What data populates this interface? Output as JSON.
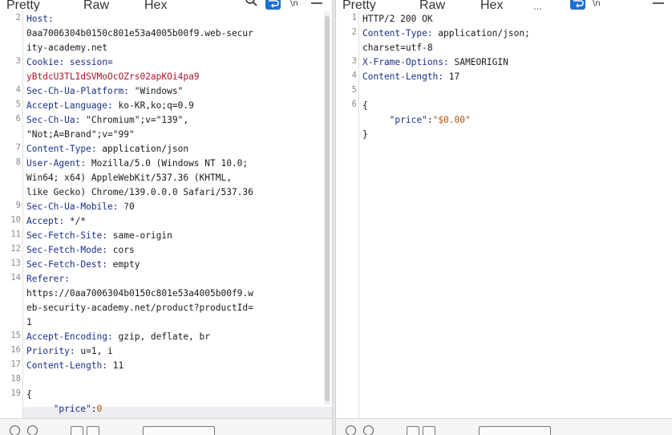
{
  "tabs": {
    "pretty": "Pretty",
    "raw": "Raw",
    "hex": "Hex",
    "more": "..."
  },
  "request": {
    "lines": [
      {
        "n": "2",
        "parts": [
          {
            "t": "Host:",
            "c": "hk"
          }
        ]
      },
      {
        "n": "",
        "parts": [
          {
            "t": "0aa7006304b0150c801e53a4005b00f9.web-secur",
            "c": ""
          }
        ]
      },
      {
        "n": "",
        "parts": [
          {
            "t": "ity-academy.net",
            "c": ""
          }
        ]
      },
      {
        "n": "3",
        "parts": [
          {
            "t": "Cookie: session=",
            "c": "hk"
          }
        ]
      },
      {
        "n": "",
        "parts": [
          {
            "t": "yBtdcU3TLIdSVMoOcOZrs02apKOi4pa9",
            "c": "rv"
          }
        ]
      },
      {
        "n": "4",
        "parts": [
          {
            "t": "Sec-Ch-Ua-Platform:",
            "c": "hk"
          },
          {
            "t": " \"Windows\"",
            "c": ""
          }
        ]
      },
      {
        "n": "5",
        "parts": [
          {
            "t": "Accept-Language:",
            "c": "hk"
          },
          {
            "t": " ko-KR,ko;q=0.9",
            "c": ""
          }
        ]
      },
      {
        "n": "6",
        "parts": [
          {
            "t": "Sec-Ch-Ua:",
            "c": "hk"
          },
          {
            "t": " \"Chromium\";v=\"139\",",
            "c": ""
          }
        ]
      },
      {
        "n": "",
        "parts": [
          {
            "t": "\"Not;A=Brand\";v=\"99\"",
            "c": ""
          }
        ]
      },
      {
        "n": "7",
        "parts": [
          {
            "t": "Content-Type:",
            "c": "hk"
          },
          {
            "t": " application/json",
            "c": ""
          }
        ]
      },
      {
        "n": "8",
        "parts": [
          {
            "t": "User-Agent:",
            "c": "hk"
          },
          {
            "t": " Mozilla/5.0 (Windows NT 10.0;",
            "c": ""
          }
        ]
      },
      {
        "n": "",
        "parts": [
          {
            "t": "Win64; x64) AppleWebKit/537.36 (KHTML,",
            "c": ""
          }
        ]
      },
      {
        "n": "",
        "parts": [
          {
            "t": "like Gecko) Chrome/139.0.0.0 Safari/537.36",
            "c": ""
          }
        ]
      },
      {
        "n": "9",
        "parts": [
          {
            "t": "Sec-Ch-Ua-Mobile:",
            "c": "hk"
          },
          {
            "t": " ?0",
            "c": ""
          }
        ]
      },
      {
        "n": "10",
        "parts": [
          {
            "t": "Accept:",
            "c": "hk"
          },
          {
            "t": " */*",
            "c": ""
          }
        ]
      },
      {
        "n": "11",
        "parts": [
          {
            "t": "Sec-Fetch-Site:",
            "c": "hk"
          },
          {
            "t": " same-origin",
            "c": ""
          }
        ]
      },
      {
        "n": "12",
        "parts": [
          {
            "t": "Sec-Fetch-Mode:",
            "c": "hk"
          },
          {
            "t": " cors",
            "c": ""
          }
        ]
      },
      {
        "n": "13",
        "parts": [
          {
            "t": "Sec-Fetch-Dest:",
            "c": "hk"
          },
          {
            "t": " empty",
            "c": ""
          }
        ]
      },
      {
        "n": "14",
        "parts": [
          {
            "t": "Referer:",
            "c": "hk"
          }
        ]
      },
      {
        "n": "",
        "parts": [
          {
            "t": "https://0aa7006304b0150c801e53a4005b00f9.w",
            "c": ""
          }
        ]
      },
      {
        "n": "",
        "parts": [
          {
            "t": "eb-security-academy.net/product?productId=",
            "c": ""
          }
        ]
      },
      {
        "n": "",
        "parts": [
          {
            "t": "1",
            "c": ""
          }
        ]
      },
      {
        "n": "15",
        "parts": [
          {
            "t": "Accept-Encoding:",
            "c": "hk"
          },
          {
            "t": " gzip, deflate, br",
            "c": ""
          }
        ]
      },
      {
        "n": "16",
        "parts": [
          {
            "t": "Priority:",
            "c": "hk"
          },
          {
            "t": " u=1, i",
            "c": ""
          }
        ]
      },
      {
        "n": "17",
        "parts": [
          {
            "t": "Content-Length:",
            "c": "hk"
          },
          {
            "t": " 11",
            "c": ""
          }
        ]
      },
      {
        "n": "18",
        "parts": []
      },
      {
        "n": "19",
        "parts": [
          {
            "t": "{",
            "c": ""
          }
        ]
      },
      {
        "n": "",
        "parts": [
          {
            "t": "     \"price\"",
            "c": "jk"
          },
          {
            "t": ":",
            "c": ""
          },
          {
            "t": "0",
            "c": "jv"
          }
        ]
      },
      {
        "n": "",
        "parts": [
          {
            "t": "}",
            "c": ""
          }
        ]
      }
    ]
  },
  "response": {
    "lines": [
      {
        "n": "1",
        "parts": [
          {
            "t": "HTTP/2 200 OK",
            "c": ""
          }
        ]
      },
      {
        "n": "2",
        "parts": [
          {
            "t": "Content-Type:",
            "c": "hk"
          },
          {
            "t": " application/json;",
            "c": ""
          }
        ]
      },
      {
        "n": "",
        "parts": [
          {
            "t": "charset=utf-8",
            "c": ""
          }
        ]
      },
      {
        "n": "3",
        "parts": [
          {
            "t": "X-Frame-Options:",
            "c": "hk"
          },
          {
            "t": " SAMEORIGIN",
            "c": ""
          }
        ]
      },
      {
        "n": "4",
        "parts": [
          {
            "t": "Content-Length:",
            "c": "hk"
          },
          {
            "t": " 17",
            "c": ""
          }
        ]
      },
      {
        "n": "5",
        "parts": []
      },
      {
        "n": "6",
        "parts": [
          {
            "t": "{",
            "c": ""
          }
        ]
      },
      {
        "n": "",
        "parts": [
          {
            "t": "     \"price\"",
            "c": "jk"
          },
          {
            "t": ":",
            "c": ""
          },
          {
            "t": "\"$0.00\"",
            "c": "jv"
          }
        ]
      },
      {
        "n": "",
        "parts": [
          {
            "t": "}",
            "c": ""
          }
        ]
      }
    ]
  },
  "colors": {
    "accent": "#1c6fd1",
    "header_key": "#1a2f8a",
    "cookie_value": "#b0142c",
    "json_value": "#b05000"
  }
}
